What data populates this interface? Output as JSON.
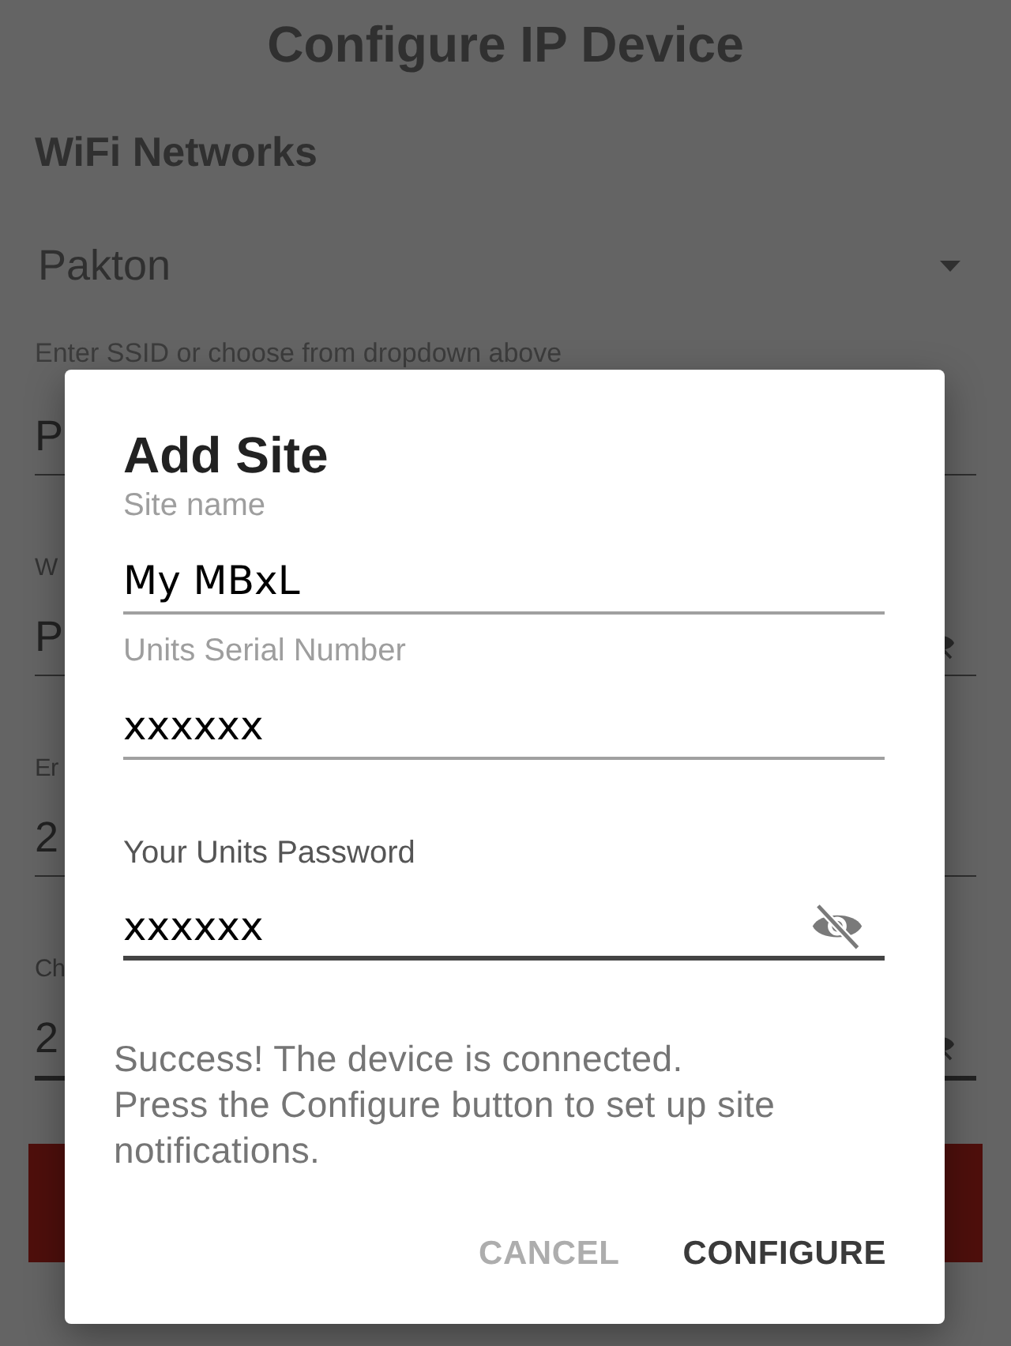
{
  "screen": {
    "title": "Configure IP Device"
  },
  "background": {
    "section_title": "WiFi Networks",
    "network_dropdown": {
      "value": "Pakton"
    },
    "ssid_hint": "Enter SSID or choose from dropdown above",
    "fields": [
      {
        "kind": "text",
        "value": "P",
        "focused": false
      },
      {
        "kind": "password",
        "label": "W",
        "value": "P",
        "focused": false
      },
      {
        "kind": "text",
        "label": "Er",
        "value": "2",
        "focused": false
      },
      {
        "kind": "password",
        "label": "Ch",
        "value": "2",
        "focused": true
      }
    ]
  },
  "dialog": {
    "title": "Add Site",
    "fields": [
      {
        "kind": "text",
        "label": "Site name",
        "value": "My MBxL",
        "focused": false
      },
      {
        "kind": "text",
        "label": "Units Serial Number",
        "value": "xxxxxx",
        "focused": false
      },
      {
        "kind": "password",
        "label": "Your Units Password",
        "value": "xxxxxx",
        "focused": true
      }
    ],
    "message": "Success! The device is connected.\nPress the Configure button to set up site notifications.",
    "buttons": [
      {
        "label": "CANCEL",
        "disabled": true
      },
      {
        "label": "CONFIGURE",
        "disabled": false
      }
    ]
  }
}
